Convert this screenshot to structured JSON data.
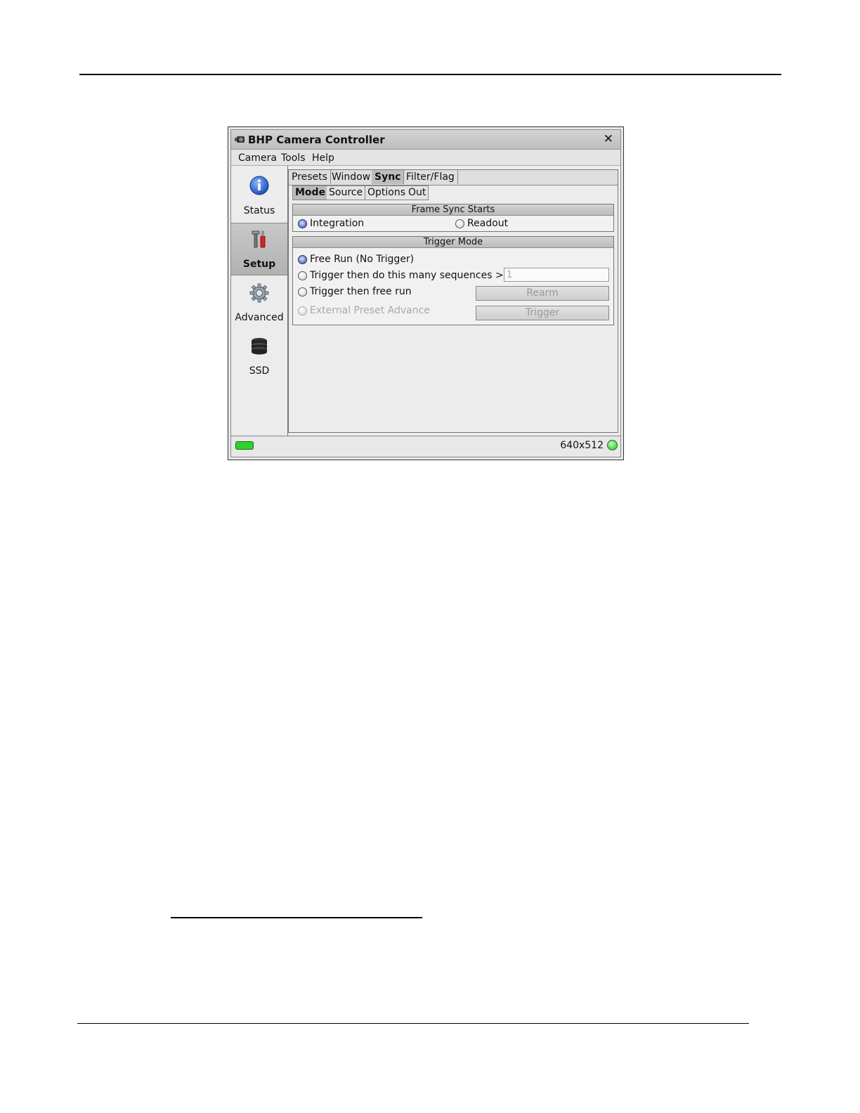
{
  "window": {
    "title": "BHP Camera Controller",
    "close_glyph": "✕"
  },
  "menu": [
    "Camera",
    "Tools",
    "Help"
  ],
  "sidebar": {
    "items": [
      {
        "label": "Status",
        "icon": "info-icon",
        "active": false
      },
      {
        "label": "Setup",
        "icon": "tools-icon",
        "active": true
      },
      {
        "label": "Advanced",
        "icon": "gear-icon",
        "active": false
      },
      {
        "label": "SSD",
        "icon": "disk-stack-icon",
        "active": false
      }
    ]
  },
  "tabs": [
    "Presets",
    "Window",
    "Sync",
    "Filter/Flag"
  ],
  "active_tab": "Sync",
  "subtabs": [
    "Mode",
    "Source",
    "Options",
    "Out"
  ],
  "active_subtab": "Mode",
  "frame_sync": {
    "title": "Frame Sync Starts",
    "options": [
      {
        "label": "Integration",
        "selected": true
      },
      {
        "label": "Readout",
        "selected": false
      }
    ]
  },
  "trigger_mode": {
    "title": "Trigger Mode",
    "options": [
      {
        "label": "Free Run (No Trigger)",
        "selected": true,
        "enabled": true
      },
      {
        "label": "Trigger then do this many sequences >>",
        "selected": false,
        "enabled": true
      },
      {
        "label": "Trigger then free run",
        "selected": false,
        "enabled": true
      },
      {
        "label": "External Preset Advance",
        "selected": false,
        "enabled": false
      }
    ],
    "sequence_count": "1",
    "rearm_label": "Rearm",
    "trigger_label": "Trigger"
  },
  "status": {
    "resolution": "640x512",
    "colors": {
      "led": "#2fd12f",
      "accent": "#3a5bc4"
    }
  }
}
